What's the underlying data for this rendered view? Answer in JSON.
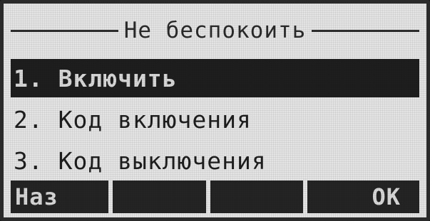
{
  "screen": {
    "title": "Не беспокоить"
  },
  "menu": {
    "items": [
      {
        "label": "1. Включить",
        "selected": true
      },
      {
        "label": "2. Код включения",
        "selected": false
      },
      {
        "label": "3. Код выключения",
        "selected": false
      }
    ]
  },
  "softkeys": {
    "key1": "Наз",
    "key2": "",
    "key3": "",
    "key4": "OK"
  },
  "colors": {
    "lcd_background": "#e4e4e4",
    "lcd_foreground": "#1e1e1e",
    "highlight_text": "#d8d8d8"
  }
}
